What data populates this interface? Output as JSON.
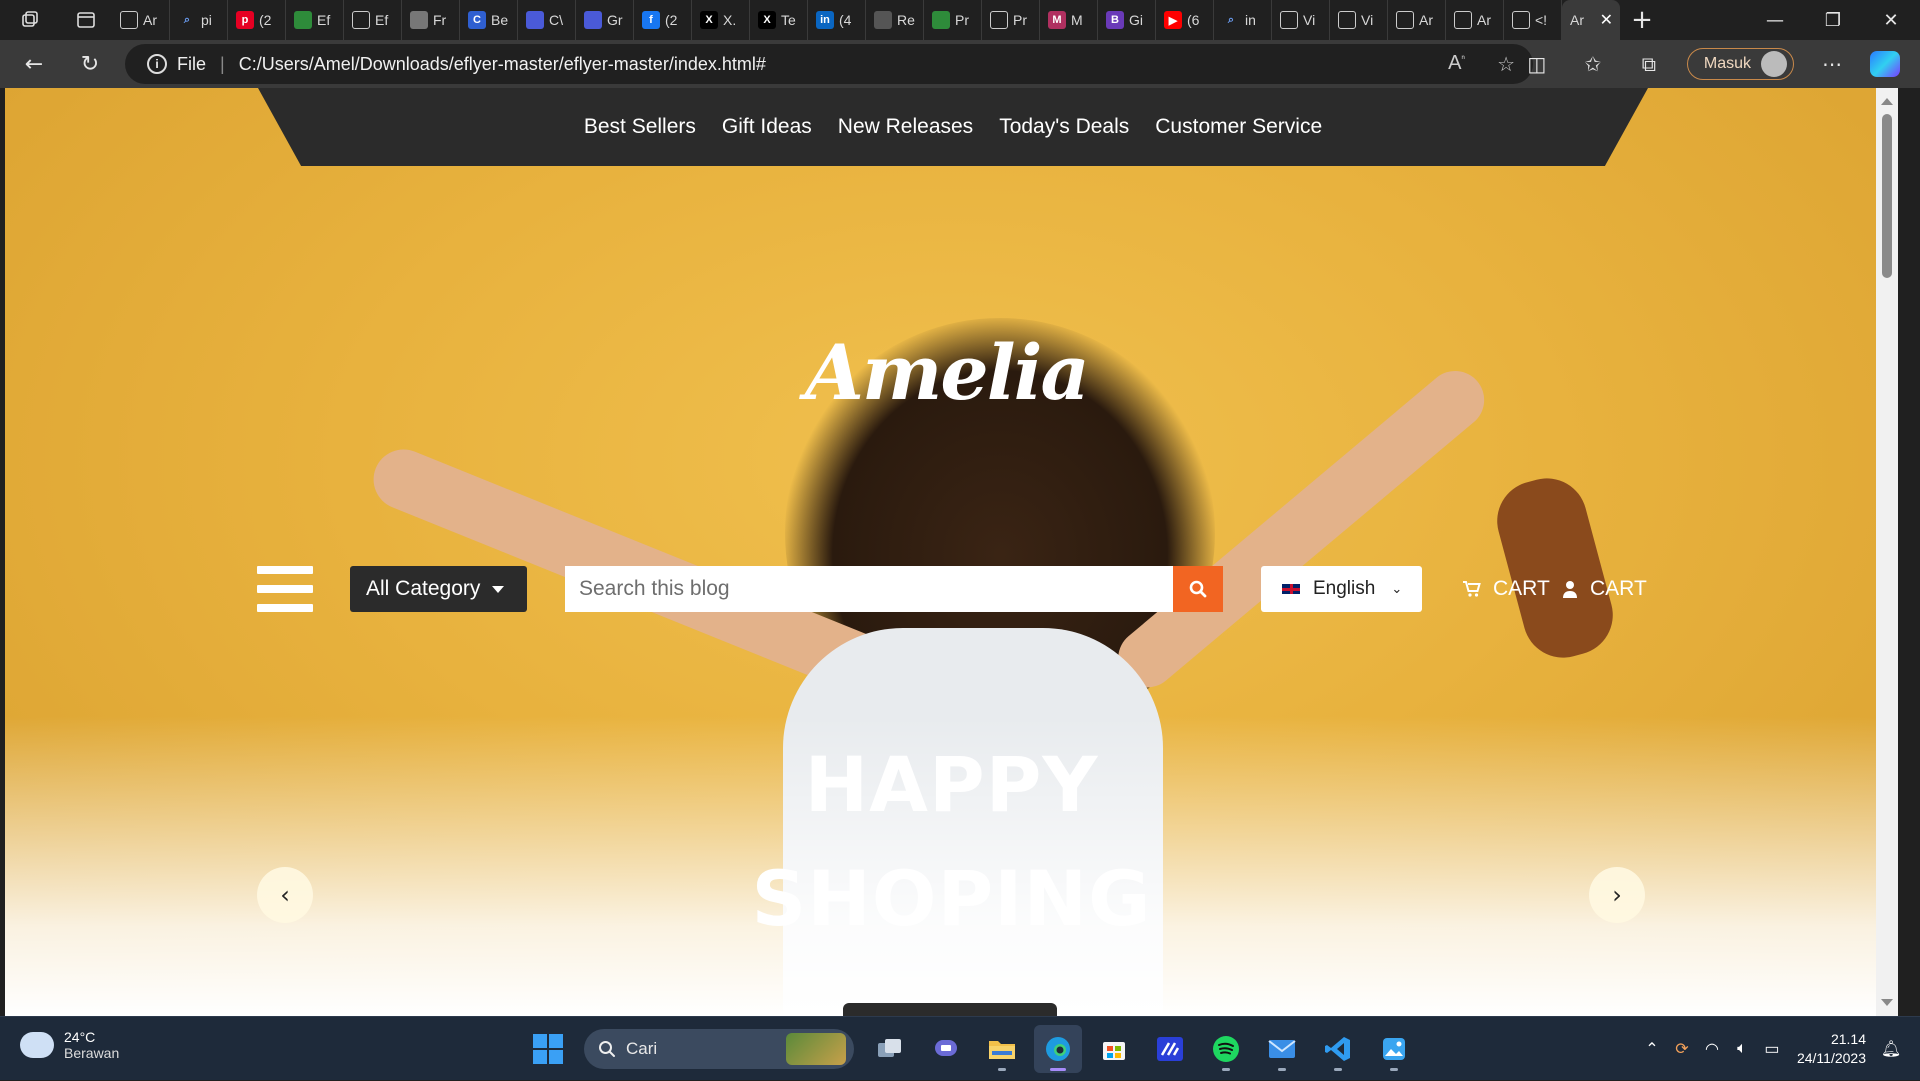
{
  "browser": {
    "tabs": [
      {
        "label": "Ar",
        "fav": "doc"
      },
      {
        "label": "pi",
        "fav": "search"
      },
      {
        "label": "(2",
        "fav": "pinterest"
      },
      {
        "label": "Ef",
        "fav": "leaf"
      },
      {
        "label": "Ef",
        "fav": "doc"
      },
      {
        "label": "Fr",
        "fav": "img"
      },
      {
        "label": "Be",
        "fav": "c"
      },
      {
        "label": "C\\",
        "fav": "monitor"
      },
      {
        "label": "Gr",
        "fav": "monitor"
      },
      {
        "label": "(2",
        "fav": "facebook"
      },
      {
        "label": "X.",
        "fav": "x"
      },
      {
        "label": "Te",
        "fav": "x"
      },
      {
        "label": "(4",
        "fav": "linkedin"
      },
      {
        "label": "Re",
        "fav": "layers"
      },
      {
        "label": "Pr",
        "fav": "leaf"
      },
      {
        "label": "Pr",
        "fav": "doc"
      },
      {
        "label": "M",
        "fav": "m"
      },
      {
        "label": "Gi",
        "fav": "b"
      },
      {
        "label": "(6",
        "fav": "youtube"
      },
      {
        "label": "in",
        "fav": "search"
      },
      {
        "label": "Vi",
        "fav": "doc"
      },
      {
        "label": "Vi",
        "fav": "doc"
      },
      {
        "label": "Ar",
        "fav": "doc"
      },
      {
        "label": "Ar",
        "fav": "doc"
      },
      {
        "label": "<!",
        "fav": "doc"
      }
    ],
    "active_tab": {
      "label": "Ar"
    },
    "address": {
      "scheme_label": "File",
      "url": "C:/Users/Amel/Downloads/eflyer-master/eflyer-master/index.html#"
    },
    "profile_label": "Masuk"
  },
  "page": {
    "nav": [
      "Best Sellers",
      "Gift Ideas",
      "New Releases",
      "Today's Deals",
      "Customer Service"
    ],
    "logo_text": "Amelia",
    "category_label": "All Category",
    "search_placeholder": "Search this blog",
    "language_label": "English",
    "cart_label": "CART",
    "account_label": "CART",
    "hero_line1": "HAPPY",
    "hero_line2": "SHOPING"
  },
  "taskbar": {
    "weather_temp": "24°C",
    "weather_desc": "Berawan",
    "search_label": "Cari",
    "time": "21.14",
    "date": "24/11/2023"
  },
  "colors": {
    "accent_orange": "#f26522",
    "nav_dark": "#2b2b2b",
    "hero_yellow": "#e8b23e"
  }
}
